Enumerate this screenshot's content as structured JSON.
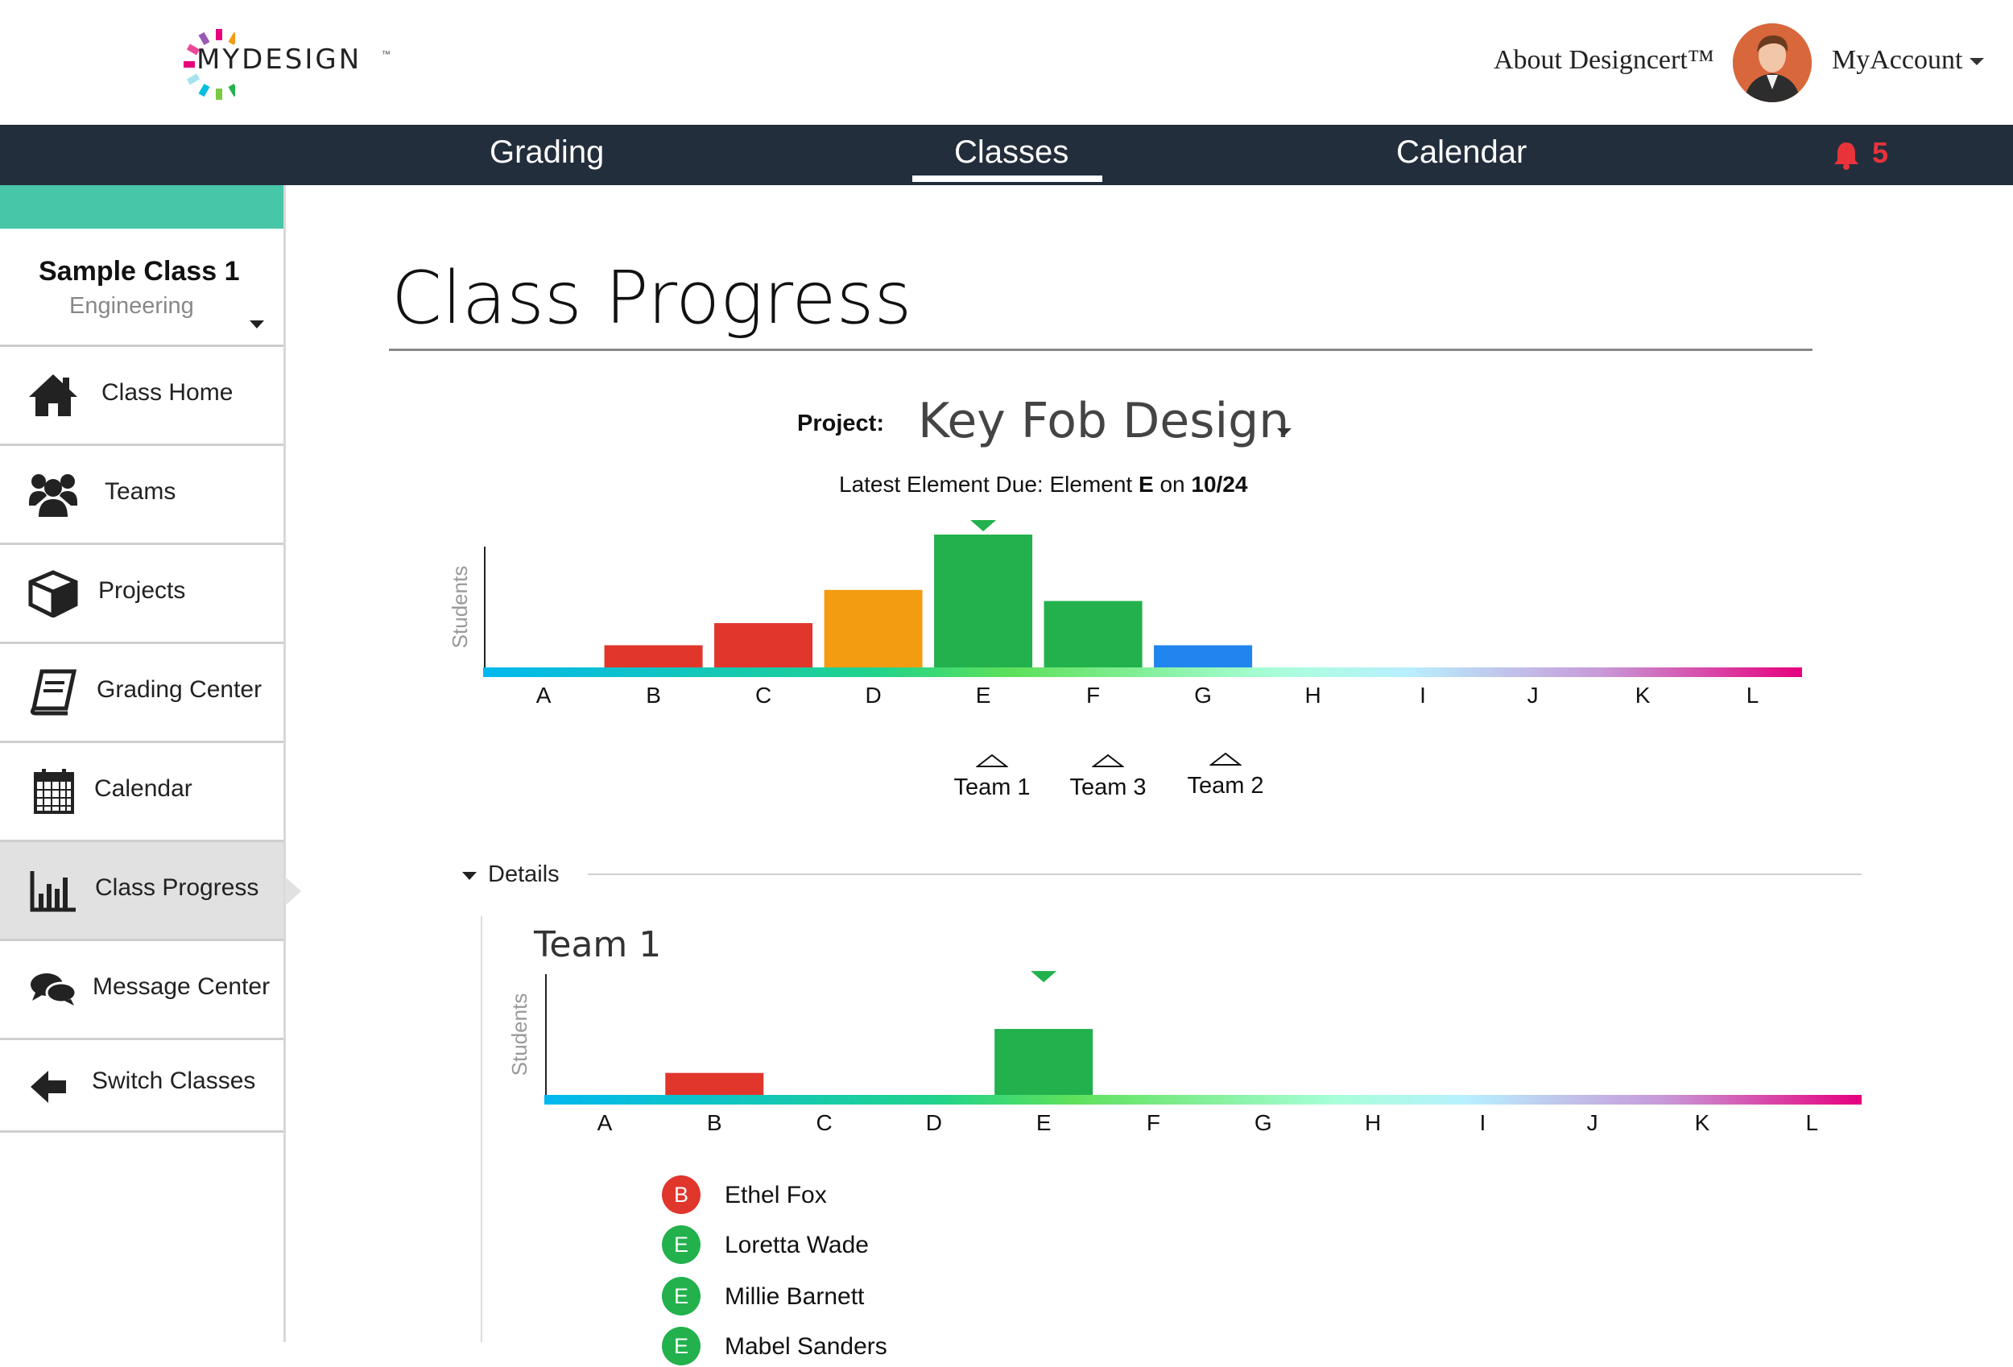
{
  "logo": {
    "text": "MYDESIGN",
    "tm": "™"
  },
  "header": {
    "about_label": "About Designcert™",
    "account_label": "MyAccount"
  },
  "nav": {
    "grading": "Grading",
    "classes": "Classes",
    "calendar": "Calendar",
    "notifications_count": "5",
    "active_tab": "Classes"
  },
  "sidebar": {
    "class_name": "Sample Class 1",
    "class_subject": "Engineering",
    "items": [
      {
        "label": "Class Home",
        "icon": "home-icon"
      },
      {
        "label": "Teams",
        "icon": "users-icon"
      },
      {
        "label": "Projects",
        "icon": "cube-icon"
      },
      {
        "label": "Grading Center",
        "icon": "book-icon"
      },
      {
        "label": "Calendar",
        "icon": "calendar-icon"
      },
      {
        "label": "Class Progress",
        "icon": "bar-chart-icon",
        "active": true
      },
      {
        "label": "Message Center",
        "icon": "chat-icon"
      },
      {
        "label": "Switch Classes",
        "icon": "arrow-left-icon"
      }
    ]
  },
  "main": {
    "title": "Class Progress",
    "project_label": "Project:",
    "project_value": "Key Fob Design",
    "due_prefix": "Latest Element Due: Element ",
    "due_element": "E",
    "due_mid": " on ",
    "due_date": "10/24",
    "teams": [
      "Team 1",
      "Team 3",
      "Team 2"
    ],
    "details_label": "Details",
    "detail_team": "Team 1",
    "students": [
      {
        "grade": "B",
        "name": "Ethel Fox",
        "color": "#e0362c"
      },
      {
        "grade": "E",
        "name": "Loretta Wade",
        "color": "#22b14c"
      },
      {
        "grade": "E",
        "name": "Millie Barnett",
        "color": "#22b14c"
      },
      {
        "grade": "E",
        "name": "Mabel Sanders",
        "color": "#22b14c"
      }
    ]
  },
  "colors": {
    "nav_bg": "#232e3c",
    "accent": "#48c6a8",
    "notification": "#e8333a",
    "current_marker": "#22b14c"
  },
  "chart_data": [
    {
      "type": "bar",
      "ylabel": "Students",
      "categories": [
        "A",
        "B",
        "C",
        "D",
        "E",
        "F",
        "G",
        "H",
        "I",
        "J",
        "K",
        "L"
      ],
      "values": [
        0,
        1,
        2,
        3.5,
        6,
        3,
        1,
        0,
        0,
        0,
        0,
        0
      ],
      "bar_colors": [
        "#e0362c",
        "#e0362c",
        "#e0362c",
        "#f39c12",
        "#22b14c",
        "#22b14c",
        "#2185f0",
        "#2185f0",
        "#2185f0",
        "#2185f0",
        "#2185f0",
        "#2185f0"
      ],
      "current_element": "E",
      "team_markers": [
        {
          "team": "Team 1",
          "element": "E"
        },
        {
          "team": "Team 3",
          "element": "F"
        },
        {
          "team": "Team 2",
          "element": "G"
        }
      ]
    },
    {
      "type": "bar",
      "ylabel": "Students",
      "categories": [
        "A",
        "B",
        "C",
        "D",
        "E",
        "F",
        "G",
        "H",
        "I",
        "J",
        "K",
        "L"
      ],
      "values": [
        0,
        1,
        0,
        0,
        3,
        0,
        0,
        0,
        0,
        0,
        0,
        0
      ],
      "bar_colors": [
        "#e0362c",
        "#e0362c",
        "#e0362c",
        "#f39c12",
        "#22b14c",
        "#22b14c",
        "#2185f0",
        "#2185f0",
        "#2185f0",
        "#2185f0",
        "#2185f0",
        "#2185f0"
      ],
      "current_element": "E"
    }
  ]
}
